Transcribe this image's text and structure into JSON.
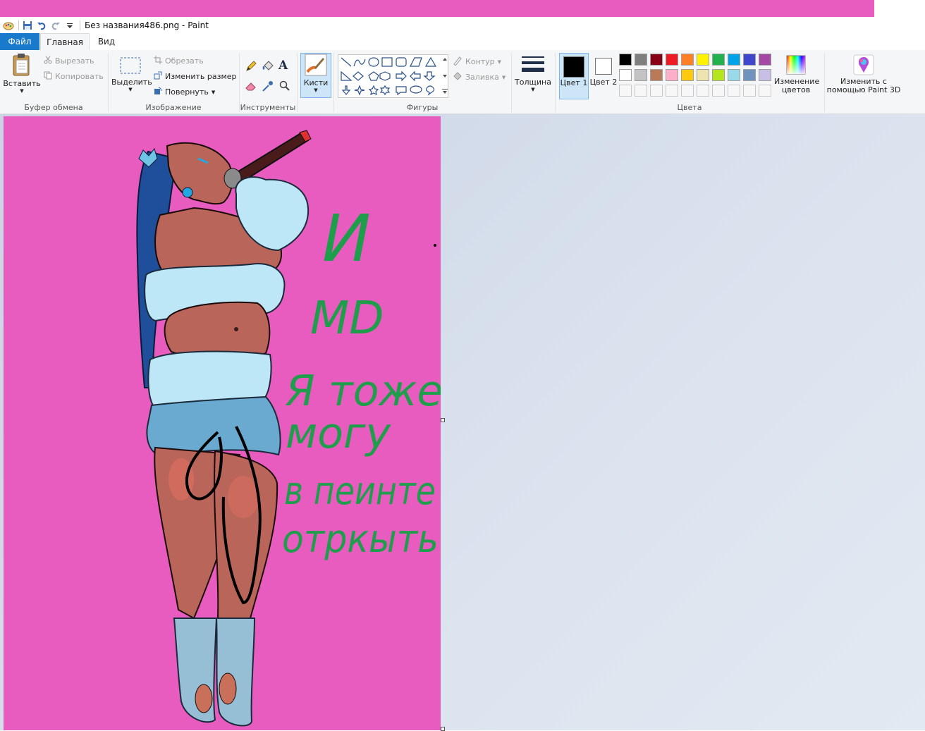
{
  "window": {
    "title": "Без названия486.png - Paint"
  },
  "tabs": {
    "file": "Файл",
    "home": "Главная",
    "view": "Вид"
  },
  "clipboard": {
    "paste": "Вставить",
    "cut": "Вырезать",
    "copy": "Копировать",
    "label": "Буфер обмена"
  },
  "image": {
    "select": "Выделить",
    "crop": "Обрезать",
    "resize": "Изменить размер",
    "rotate": "Повернуть",
    "label": "Изображение"
  },
  "tools": {
    "label": "Инструменты"
  },
  "brushes": {
    "label": "Кисти"
  },
  "shapes": {
    "outline": "Контур",
    "fill": "Заливка",
    "label": "Фигуры"
  },
  "size": {
    "label": "Толщина"
  },
  "colors": {
    "color1": "Цвет 1",
    "color2": "Цвет 2",
    "edit": "Изменение цветов",
    "label": "Цвета",
    "color1_value": "#000000",
    "color2_value": "#ffffff",
    "palette_row1": [
      "#000000",
      "#7f7f7f",
      "#880015",
      "#ed1c24",
      "#ff7f27",
      "#fff200",
      "#22b14c",
      "#00a2e8",
      "#3f48cc",
      "#a349a4"
    ],
    "palette_row2": [
      "#ffffff",
      "#c3c3c3",
      "#b97a57",
      "#ffaec9",
      "#ffc90e",
      "#efe4b0",
      "#b5e61d",
      "#99d9ea",
      "#7092be",
      "#c8bfe7"
    ]
  },
  "paint3d": {
    "label": "Изменить с помощью Paint 3D"
  },
  "canvas": {
    "background": "#e85cbf",
    "handwriting": {
      "line1": "И",
      "line2": "MD",
      "line3": "Я тоже",
      "line4": "могу",
      "line5": "в пеинте",
      "line6": "отркыть"
    }
  }
}
